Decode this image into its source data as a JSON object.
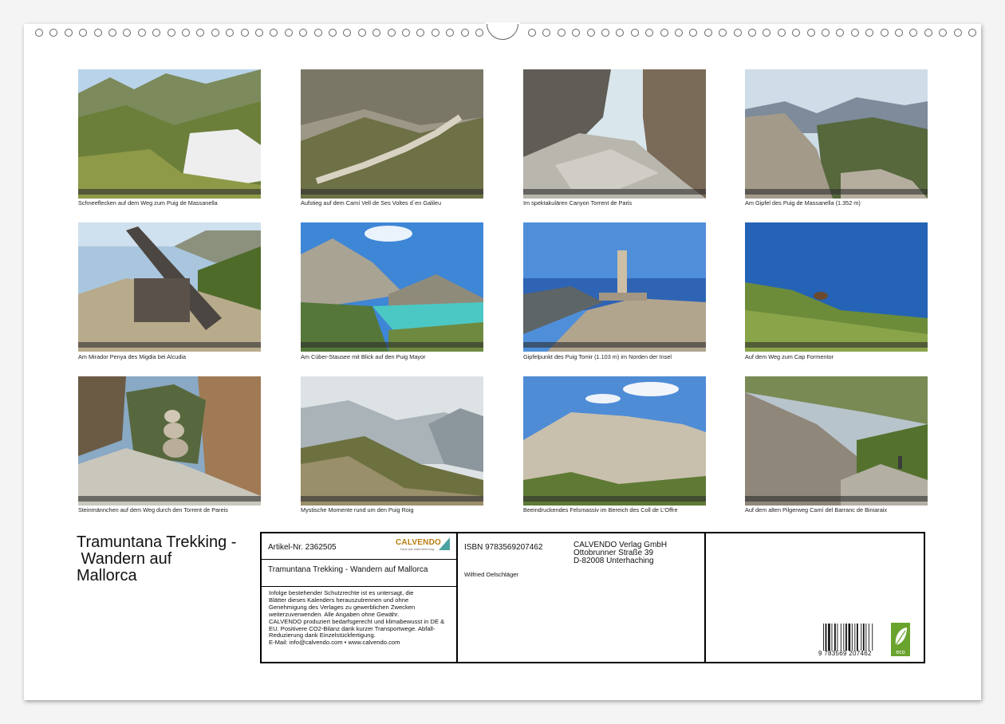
{
  "calendar": {
    "title": "Tramuntana Trekking - Wandern auf Mallorca",
    "title_lines": [
      "Tramuntana Trekking -",
      " Wandern auf",
      "Mallorca"
    ]
  },
  "photos": [
    {
      "caption": "Schneeflecken auf dem Weg zum Puig de Massanella",
      "icon": "mountain-valley-snow"
    },
    {
      "caption": "Aufstieg auf dem Camí Vell de Ses Voltes d´en Galileu",
      "icon": "switchback-trail"
    },
    {
      "caption": "Im spektakulären Canyon Torrent de Paris",
      "icon": "canyon-rocks"
    },
    {
      "caption": "Am Gipfel des Puig de Massanella (1.352 m)",
      "icon": "summit-view"
    },
    {
      "caption": "Am Mirador Penya des Migdia bei Alcudia",
      "icon": "cannon"
    },
    {
      "caption": "Am Cúber-Stausee mit Blick auf den Puig Mayor",
      "icon": "reservoir"
    },
    {
      "caption": "Gipfelpunkt des Puig Tomir (1.103 m) im Norden der Insel",
      "icon": "summit-pillar"
    },
    {
      "caption": "Auf dem Weg zum Cap Formentor",
      "icon": "coast-goat"
    },
    {
      "caption": "Steinmännchen auf dem Weg durch den Torrent de Pareis",
      "icon": "cairn"
    },
    {
      "caption": "Mystische Momente rund um den Puig Roig",
      "icon": "misty-hills"
    },
    {
      "caption": "Beeindruckendes Felsmassiv im Bereich des Coll de L'Offre",
      "icon": "rock-massif"
    },
    {
      "caption": "Auf dem alten Pilgerweg Camí del Barranc de Biniaraix",
      "icon": "stone-path-hiker"
    }
  ],
  "info_box": {
    "article_no": "Artikel-Nr. 2362505",
    "logo": "CALVENDO",
    "logo_sub": "fotos wie wahrnehmung",
    "title": "Tramuntana Trekking - Wandern auf Mallorca",
    "legal_lines": [
      "Infolge bestehender Schutzrechte ist es untersagt, die",
      "Blätter dieses Kalenders herauszutrennen und ohne",
      "Genehmigung des Verlages zu gewerblichen Zwecken",
      "weiterzuverwenden. Alle Angaben ohne Gewähr.",
      "CALVENDO produziert bedarfsgerecht und klimabewusst in DE &",
      "EU. Positivere CO2-Bilanz dank kurzer Transportwege. Abfall-",
      "Reduzierung dank Einzelstückfertigung.",
      "E-Mail: info@calvendo.com • www.calvendo.com"
    ],
    "isbn": "ISBN 9783569207462",
    "author": "Wilfried Oelschläger",
    "publisher_lines": [
      "CALVENDO Verlag GmbH",
      "Ottobrunner Straße 39",
      "D-82008 Unterhaching"
    ],
    "barcode_number": "9 783569 207462",
    "eco_label": "eco"
  },
  "colors": {
    "brand": "#b87d0e",
    "eco_green": "#6aa32e"
  }
}
